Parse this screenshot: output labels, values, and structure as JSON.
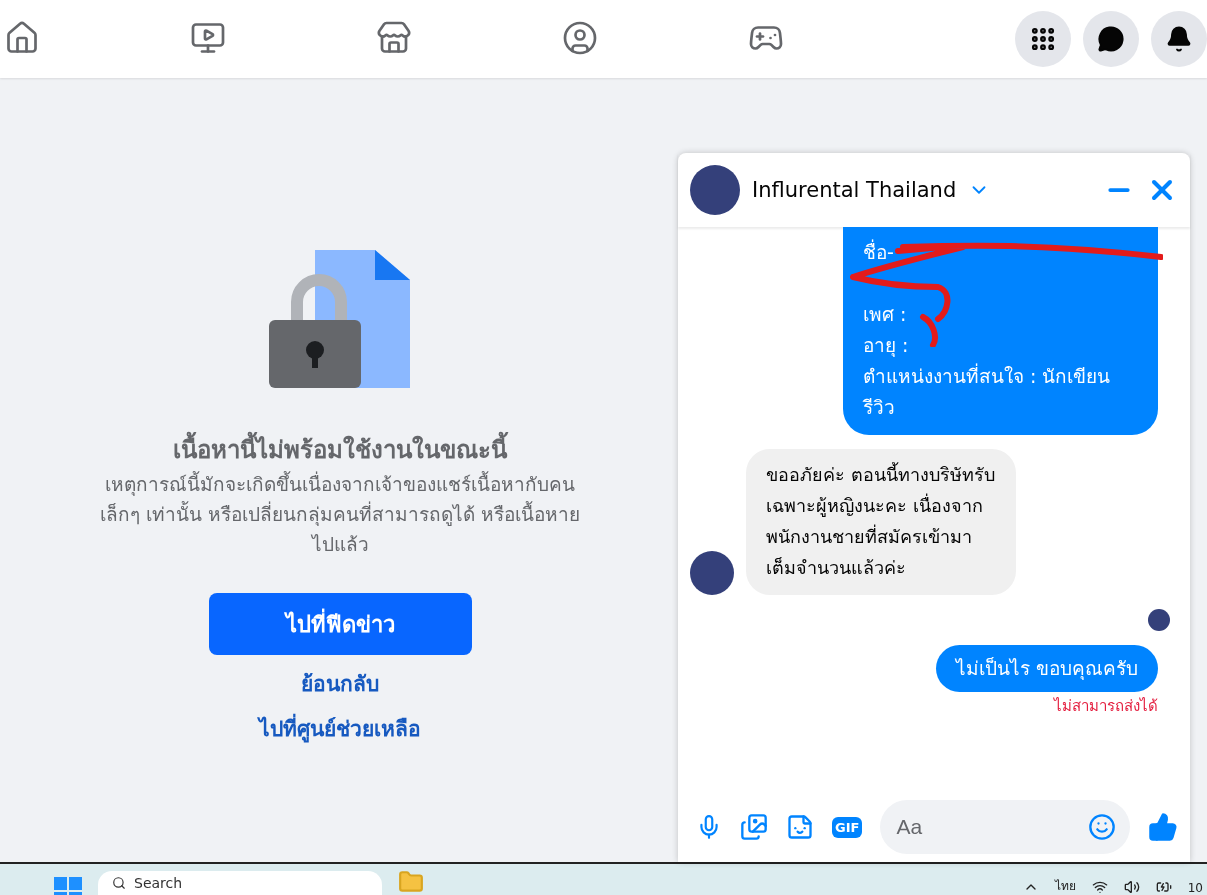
{
  "top_nav": {
    "tabs": [
      {
        "kind": "home",
        "selected": false
      },
      {
        "kind": "video",
        "selected": false
      },
      {
        "kind": "store",
        "selected": false
      },
      {
        "kind": "groups",
        "selected": false
      },
      {
        "kind": "gaming",
        "selected": false
      }
    ],
    "actions": [
      {
        "kind": "menu"
      },
      {
        "kind": "messenger"
      },
      {
        "kind": "bell"
      }
    ]
  },
  "notice": {
    "title": "เนื้อหานี้ไม่พร้อมใช้งานในขณะนี้",
    "lines": [
      "เหตุการณ์นี้มักจะเกิดขึ้นเนื่องจากเจ้าของแชร์เนื้อหากับคน",
      "เล็กๆ เท่านั้น หรือเปลี่ยนกลุ่มคนที่สามารถดูได้ หรือเนื้อหาย",
      "ไปแล้ว"
    ],
    "primary_button": "ไปที่ฟีดข่าว",
    "links": [
      "ย้อนกลับ",
      "ไปที่ศูนย์ช่วยเหลือ"
    ]
  },
  "chat": {
    "title": "Influrental Thailand",
    "messages": [
      {
        "kind": "sent",
        "lines": [
          "ชื่อ-",
          "เพศ :",
          "อายุ :",
          "ตำแหน่งงานที่สนใจ : นักเขียนรีวิว"
        ],
        "redacted": true
      },
      {
        "kind": "received",
        "text": "ขออภัยค่ะ ตอนนี้ทางบริษัทรับเฉพาะผู้หญิงนะคะ เนื่องจากพนักงานชายที่สมัครเข้ามาเต็มจำนวนแล้วค่ะ"
      },
      {
        "kind": "seen"
      },
      {
        "kind": "sent",
        "text": "ไม่เป็นไร ขอบคุณครับ",
        "error": "ไม่สามารถส่งได้"
      }
    ],
    "composer": {
      "gif": "GIF",
      "placeholder": "Aa"
    }
  },
  "taskbar": {
    "search": "Search",
    "language": "ไทย",
    "clock": "10"
  }
}
